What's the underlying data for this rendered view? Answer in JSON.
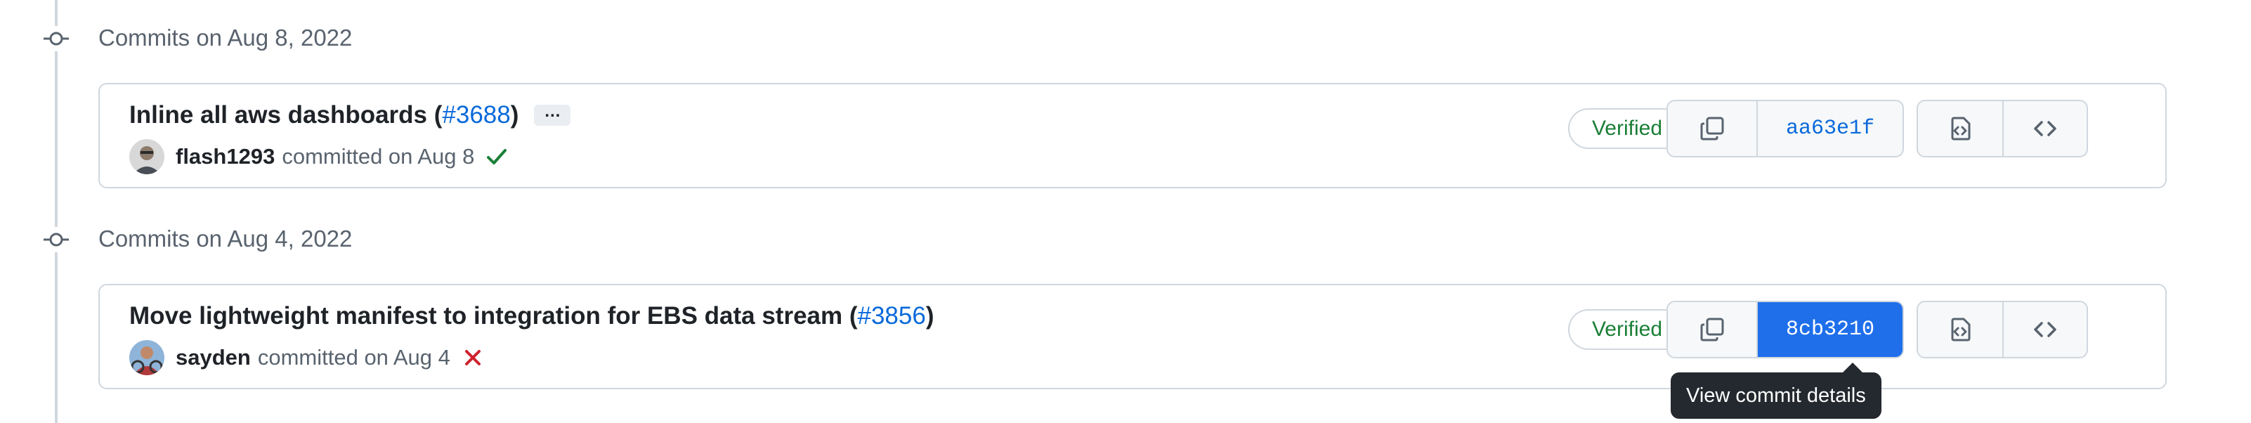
{
  "groups": [
    {
      "heading": "Commits on Aug 8, 2022",
      "commit": {
        "title": "Inline all aws dashboards (",
        "pr": "#3688",
        "title_end": ")",
        "more_label": "…",
        "author": "flash1293",
        "meta": "committed on Aug 8",
        "status": "success",
        "verified": "Verified",
        "sha": "aa63e1f"
      }
    },
    {
      "heading": "Commits on Aug 4, 2022",
      "commit": {
        "title": "Move lightweight manifest to integration for EBS data stream (",
        "pr": "#3856",
        "title_end": ")",
        "author": "sayden",
        "meta": "committed on Aug 4",
        "status": "failure",
        "verified": "Verified",
        "sha": "8cb3210"
      }
    }
  ],
  "tooltip": "View commit details",
  "icons": {
    "timeline": "git-commit-icon",
    "copy": "copy-icon",
    "browse": "file-code-icon",
    "code": "code-icon",
    "success": "check-icon",
    "failure": "x-icon"
  },
  "colors": {
    "link": "#0969da",
    "verified": "#1a7f37",
    "success": "#1a7f37",
    "failure": "#cf222e",
    "active_sha_bg": "#1f6feb",
    "tooltip_bg": "#24292f"
  }
}
